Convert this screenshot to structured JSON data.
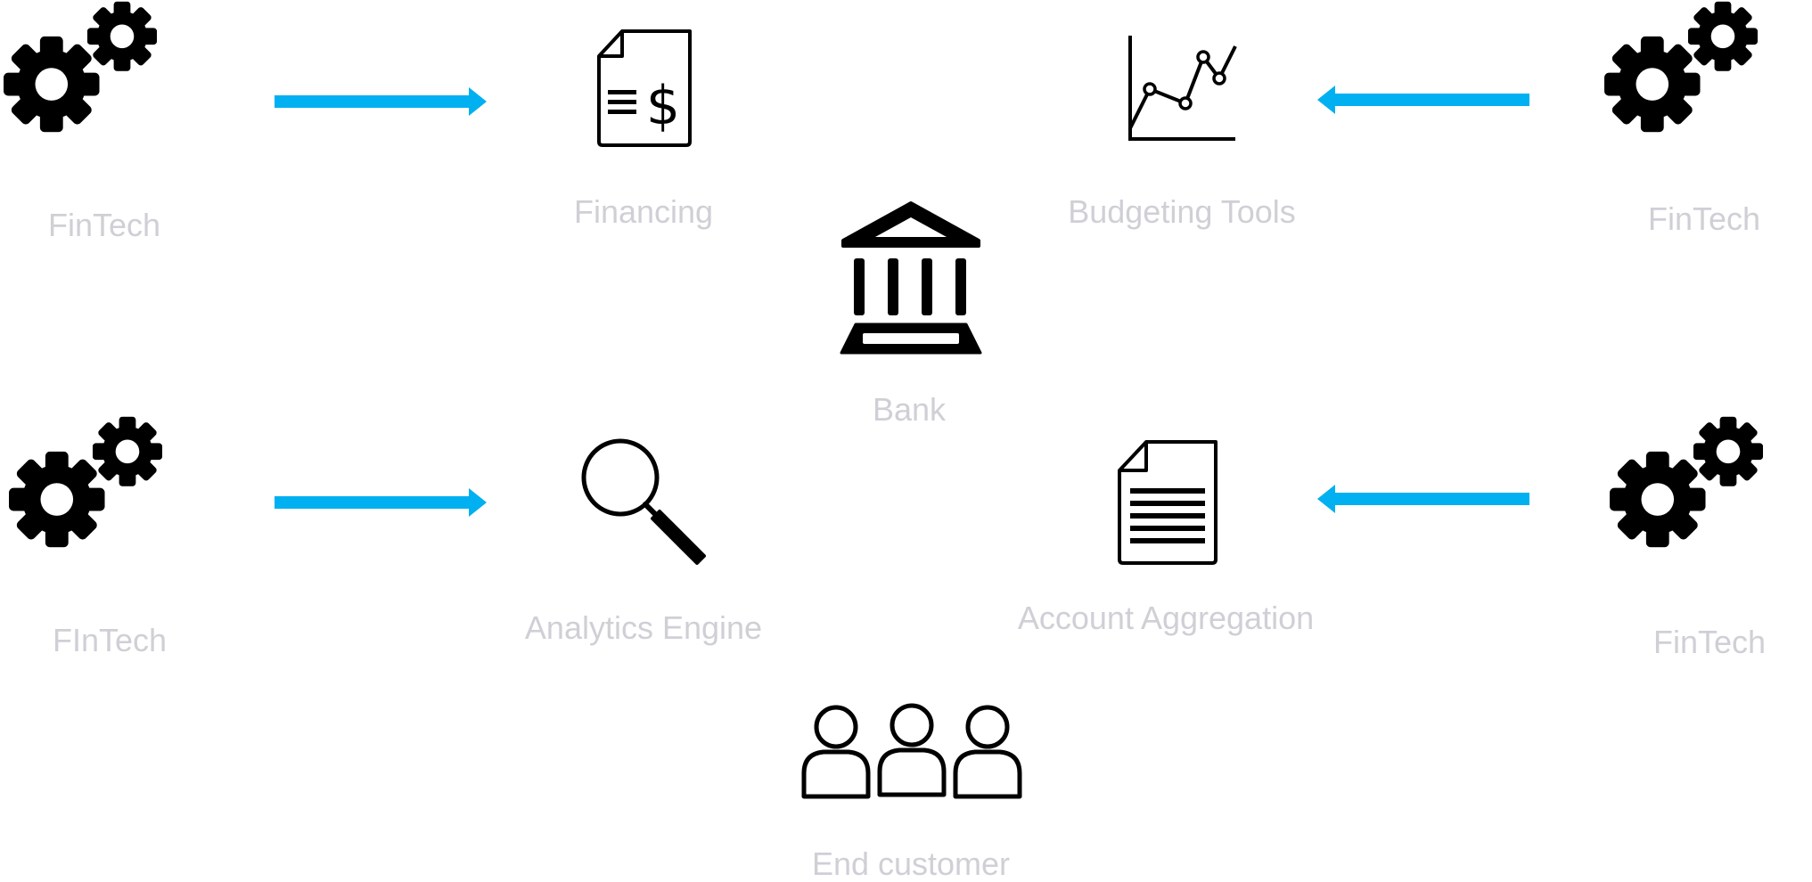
{
  "colors": {
    "arrow": "#00b0f0",
    "icon": "#000000",
    "label": "#cfcfd6"
  },
  "nodes": {
    "fintech_top_left": {
      "label": "FinTech",
      "icon": "gears-icon"
    },
    "financing": {
      "label": "Financing",
      "icon": "invoice-dollar-icon"
    },
    "budgeting_tools": {
      "label": "Budgeting Tools",
      "icon": "line-chart-icon"
    },
    "fintech_top_right": {
      "label": "FinTech",
      "icon": "gears-icon"
    },
    "bank": {
      "label": "Bank",
      "icon": "bank-icon"
    },
    "fintech_bottom_left": {
      "label": "FInTech",
      "icon": "gears-icon"
    },
    "analytics_engine": {
      "label": "Analytics Engine",
      "icon": "magnifier-icon"
    },
    "account_aggregation": {
      "label": "Account Aggregation",
      "icon": "document-icon"
    },
    "fintech_bottom_right": {
      "label": "FinTech",
      "icon": "gears-icon"
    },
    "end_customer": {
      "label": "End customer",
      "icon": "people-icon"
    }
  },
  "edges": [
    {
      "from": "fintech_top_left",
      "to": "financing"
    },
    {
      "from": "fintech_top_right",
      "to": "budgeting_tools"
    },
    {
      "from": "fintech_bottom_left",
      "to": "analytics_engine"
    },
    {
      "from": "fintech_bottom_right",
      "to": "account_aggregation"
    }
  ]
}
